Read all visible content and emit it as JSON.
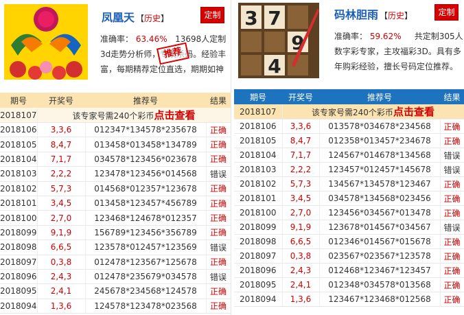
{
  "left": {
    "name": "凤凰天",
    "history": "历史",
    "custom_label": "定制",
    "accuracy_label": "准确率：",
    "accuracy_value": "63.46%",
    "custom_count": "13698人定制",
    "desc": "3d走势分析师，专攻杀码。经验丰富，每期精荐定位直选，期期如神",
    "stamp": "推荐",
    "headers": [
      "期号",
      "开奖号",
      "推荐号",
      "结果"
    ],
    "notice_issue": "2018107",
    "notice_text": "该专家号需240个彩币",
    "notice_cta": "点击查看",
    "rows": [
      {
        "issue": "2018106",
        "draw": "3,3,6",
        "pred": "012347*134578*235678",
        "result": "正确"
      },
      {
        "issue": "2018105",
        "draw": "8,4,7",
        "pred": "013458*013458*134789",
        "result": "正确"
      },
      {
        "issue": "2018104",
        "draw": "7,1,7",
        "pred": "034578*123456*023678",
        "result": "正确"
      },
      {
        "issue": "2018103",
        "draw": "2,2,2",
        "pred": "123478*123456*014568",
        "result": "错误"
      },
      {
        "issue": "2018102",
        "draw": "5,7,3",
        "pred": "014568*012357*123678",
        "result": "正确"
      },
      {
        "issue": "2018101",
        "draw": "3,4,5",
        "pred": "013458*123457*456789",
        "result": "正确"
      },
      {
        "issue": "2018100",
        "draw": "2,7,0",
        "pred": "123468*124678*012357",
        "result": "正确"
      },
      {
        "issue": "2018099",
        "draw": "9,1,9",
        "pred": "156789*123456*356789",
        "result": "正确"
      },
      {
        "issue": "2018098",
        "draw": "6,6,5",
        "pred": "123578*012457*123569",
        "result": "错误"
      },
      {
        "issue": "2018097",
        "draw": "0,3,8",
        "pred": "012478*123567*125678",
        "result": "正确"
      },
      {
        "issue": "2018096",
        "draw": "2,4,3",
        "pred": "012478*235679*034578",
        "result": "错误"
      },
      {
        "issue": "2018095",
        "draw": "2,4,1",
        "pred": "245678*234568*124578",
        "result": "正确"
      },
      {
        "issue": "2018094",
        "draw": "1,3,6",
        "pred": "124578*123478*023568",
        "result": "正确"
      }
    ]
  },
  "right": {
    "name": "码林胆雨",
    "history": "历史",
    "custom_label": "定制",
    "accuracy_label": "准确率：",
    "accuracy_value": "59.62%",
    "custom_count": "共定制305人",
    "desc": "数字彩专家，主攻福彩3D。具有多年购彩经验，擅长号码定位推荐。",
    "headers": [
      "期号",
      "开奖号",
      "推荐号",
      "结果"
    ],
    "notice_issue": "2018107",
    "notice_text": "该专家号需240个彩币",
    "notice_cta": "点击查看",
    "rows": [
      {
        "issue": "2018106",
        "draw": "3,3,6",
        "pred": "013578*034678*234568",
        "result": "正确"
      },
      {
        "issue": "2018105",
        "draw": "8,4,7",
        "pred": "012358*013457*234678",
        "result": "正确"
      },
      {
        "issue": "2018104",
        "draw": "7,1,7",
        "pred": "124567*014678*134568",
        "result": "错误"
      },
      {
        "issue": "2018103",
        "draw": "2,2,2",
        "pred": "123457*012457*145678",
        "result": "错误"
      },
      {
        "issue": "2018102",
        "draw": "5,7,3",
        "pred": "134567*134578*123467",
        "result": "正确"
      },
      {
        "issue": "2018101",
        "draw": "3,4,5",
        "pred": "034578*134568*023456",
        "result": "正确"
      },
      {
        "issue": "2018100",
        "draw": "2,7,0",
        "pred": "123456*034567*013478",
        "result": "正确"
      },
      {
        "issue": "2018099",
        "draw": "9,1,9",
        "pred": "123678*014567*034567",
        "result": "错误"
      },
      {
        "issue": "2018098",
        "draw": "6,6,5",
        "pred": "012346*014567*015678",
        "result": "正确"
      },
      {
        "issue": "2018097",
        "draw": "0,3,8",
        "pred": "023567*023567*123578",
        "result": "正确"
      },
      {
        "issue": "2018096",
        "draw": "2,4,3",
        "pred": "012468*123467*123457",
        "result": "正确"
      },
      {
        "issue": "2018095",
        "draw": "2,4,1",
        "pred": "012348*034578*013568",
        "result": "正确"
      },
      {
        "issue": "2018094",
        "draw": "1,3,6",
        "pred": "123467*123468*012568",
        "result": "正确"
      }
    ]
  },
  "colors": {
    "red": "#d00000",
    "blue": "#1e73be",
    "header_left_bg": "#fbe3b2",
    "custom_btn": "#d50000"
  }
}
